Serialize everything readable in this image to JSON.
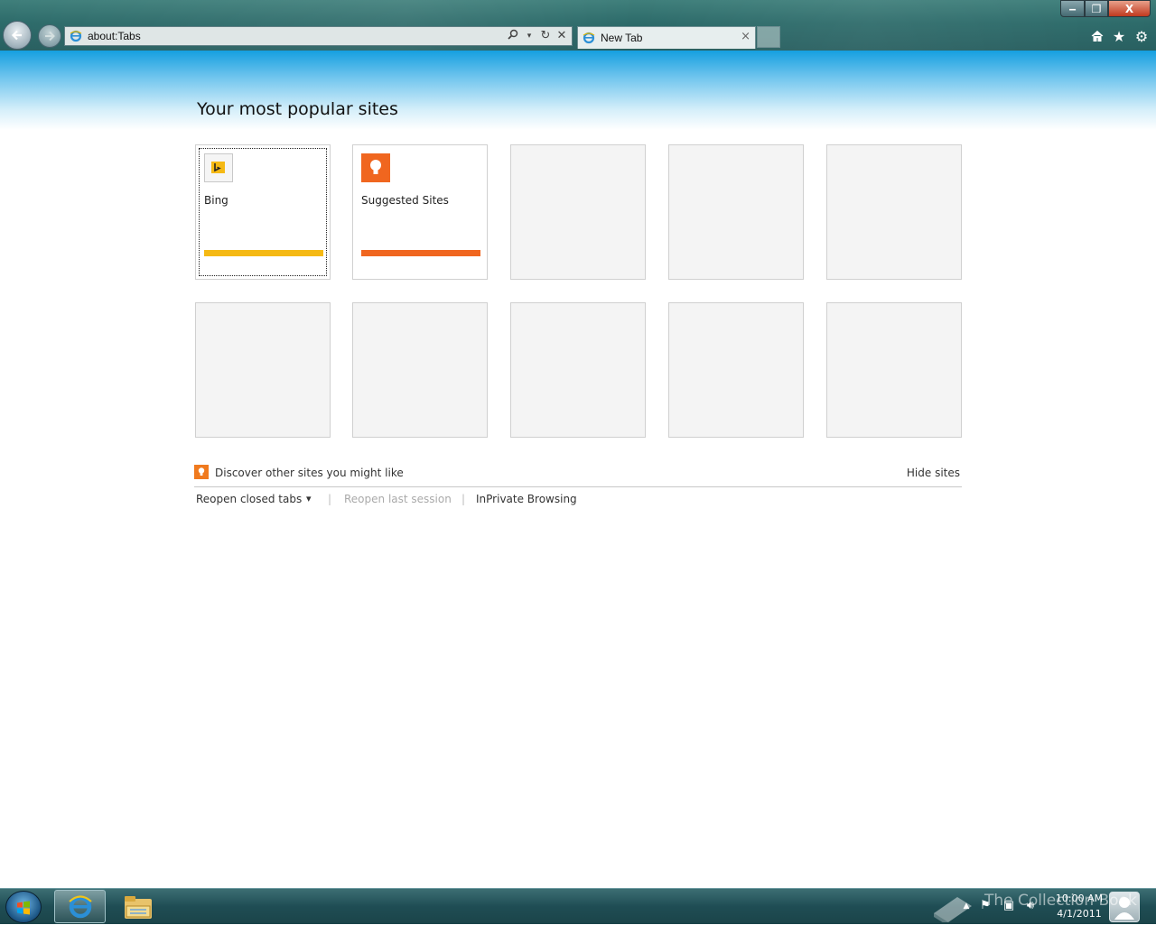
{
  "browser": {
    "address": "about:Tabs",
    "tab_label": "New Tab",
    "tab_close": "×",
    "icons": [
      "back-icon",
      "forward-icon",
      "search-icon",
      "refresh-icon",
      "stop-icon",
      "home-icon",
      "favorites-icon",
      "tools-gear-icon"
    ]
  },
  "window_controls": {
    "minimize": "‒",
    "maximize": "❐",
    "close": "X"
  },
  "page": {
    "title": "Your most popular sites",
    "tiles": [
      {
        "label": "Bing",
        "bar_color": "#f5b914",
        "icon": "bing-icon"
      },
      {
        "label": "Suggested Sites",
        "bar_color": "#f0661f",
        "icon": "lightbulb-icon"
      }
    ],
    "discover_text": "Discover other sites you might like",
    "hide_sites": "Hide sites",
    "links": {
      "reopen_closed_tabs": "Reopen closed tabs",
      "dropdown_arrow": "▾",
      "sep1": "|",
      "reopen_last_session": "Reopen last session",
      "sep2": "|",
      "inprivate": "InPrivate Browsing"
    }
  },
  "taskbar": {
    "clock_time": "10:00 AM",
    "clock_date": "4/1/2011",
    "watermark": "The Collection Book"
  },
  "colors": {
    "accent_blue": "#159fe0",
    "bing_yellow": "#f5b914",
    "suggested_orange": "#f0661f",
    "disabled_text": "#aaaaaa"
  }
}
